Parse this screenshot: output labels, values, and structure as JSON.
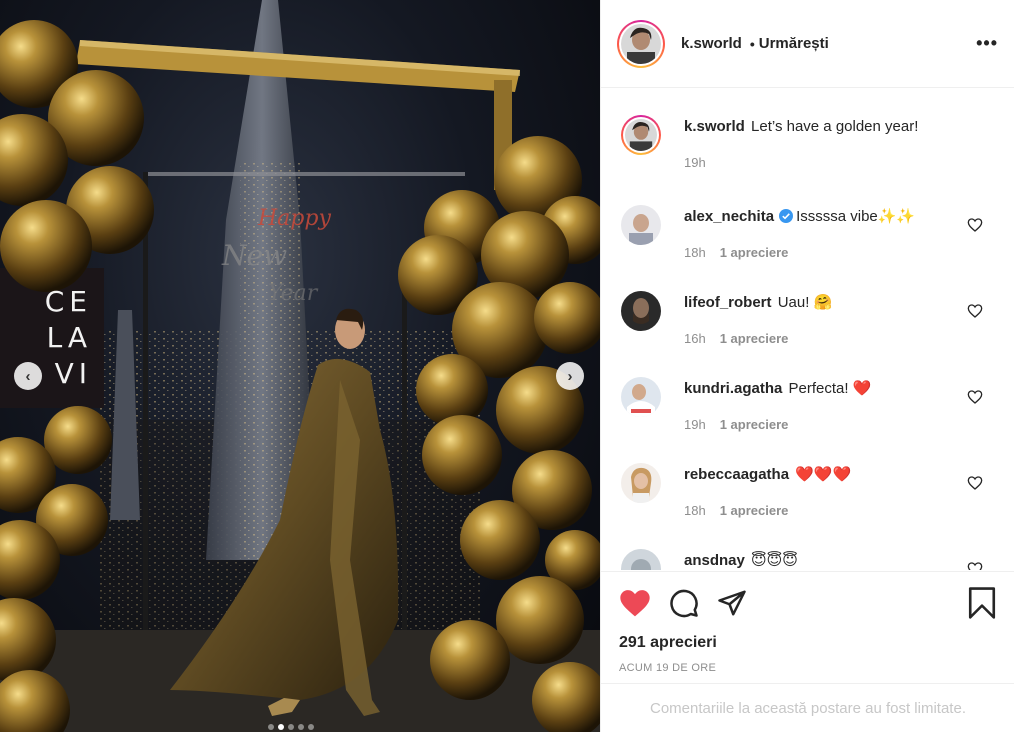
{
  "post": {
    "username": "k.sworld",
    "separator": "•",
    "follow_status": "Urmărești",
    "caption": "Let’s have a golden year!",
    "caption_time": "19h",
    "likes_count": "291 aprecieri",
    "posted_ago": "ACUM 19 DE ORE",
    "comments_limited": "Comentariile la această postare au fost limitate.",
    "more_icon": "more-options-icon",
    "liked": true
  },
  "media": {
    "sign_lines": [
      "CE",
      "LA",
      "VI"
    ],
    "carousel_dots": 5,
    "active_dot": 1,
    "prev_icon": "chevron-left-icon",
    "next_icon": "chevron-right-icon"
  },
  "comments": [
    {
      "user": "alex_nechita",
      "verified": true,
      "text": "Isssssa vibe✨✨",
      "time": "18h",
      "likes": "1 apreciere"
    },
    {
      "user": "lifeof_robert",
      "verified": false,
      "text": "Uau! 🤗",
      "time": "16h",
      "likes": "1 apreciere"
    },
    {
      "user": "kundri.agatha",
      "verified": false,
      "text": "Perfecta! ❤️",
      "time": "19h",
      "likes": "1 apreciere"
    },
    {
      "user": "rebeccaagatha",
      "verified": false,
      "text": "❤️❤️❤️",
      "time": "18h",
      "likes": "1 apreciere"
    },
    {
      "user": "ansdnay",
      "verified": false,
      "text": "😇😇😇",
      "time": "",
      "likes": ""
    }
  ],
  "colors": {
    "like_red": "#ed4956",
    "verified_blue": "#3897f0",
    "muted": "#8e8e8e",
    "gold": "#b8923a"
  }
}
